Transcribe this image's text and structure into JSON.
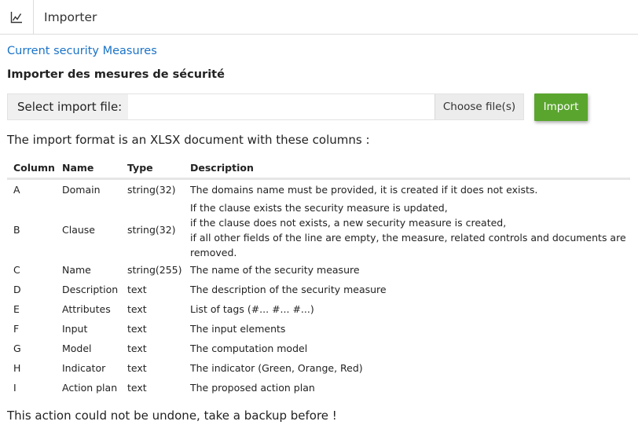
{
  "header": {
    "title": "Importer",
    "icon": "chart-line-icon"
  },
  "breadcrumb_link": "Current security Measures",
  "page_title": "Importer des mesures de sécurité",
  "import_form": {
    "file_label": "Select import file:",
    "choose_label": "Choose file(s)",
    "import_label": "Import",
    "import_color": "#5aa52e"
  },
  "intro_text": "The import format is an XLSX document with these columns :",
  "table": {
    "headers": [
      "Column",
      "Name",
      "Type",
      "Description"
    ],
    "rows": [
      {
        "column": "A",
        "name": "Domain",
        "type": "string(32)",
        "description": [
          "The domains name must be provided, it is created if it does not exists."
        ]
      },
      {
        "column": "B",
        "name": "Clause",
        "type": "string(32)",
        "description": [
          "If the clause exists the security measure is updated,",
          "if the clause does not exists, a new security measure is created,",
          "if all other fields of the line are empty, the measure, related controls and documents are removed."
        ]
      },
      {
        "column": "C",
        "name": "Name",
        "type": "string(255)",
        "description": [
          "The name of the security measure"
        ]
      },
      {
        "column": "D",
        "name": "Description",
        "type": "text",
        "description": [
          "The description of the security measure"
        ]
      },
      {
        "column": "E",
        "name": "Attributes",
        "type": "text",
        "description": [
          "List of tags (#... #... #...)"
        ]
      },
      {
        "column": "F",
        "name": "Input",
        "type": "text",
        "description": [
          "The input elements"
        ]
      },
      {
        "column": "G",
        "name": "Model",
        "type": "text",
        "description": [
          "The computation model"
        ]
      },
      {
        "column": "H",
        "name": "Indicator",
        "type": "text",
        "description": [
          "The indicator (Green, Orange, Red)"
        ]
      },
      {
        "column": "I",
        "name": "Action plan",
        "type": "text",
        "description": [
          "The proposed action plan"
        ]
      }
    ]
  },
  "footer_warning": "This action could not be undone, take a backup before !"
}
